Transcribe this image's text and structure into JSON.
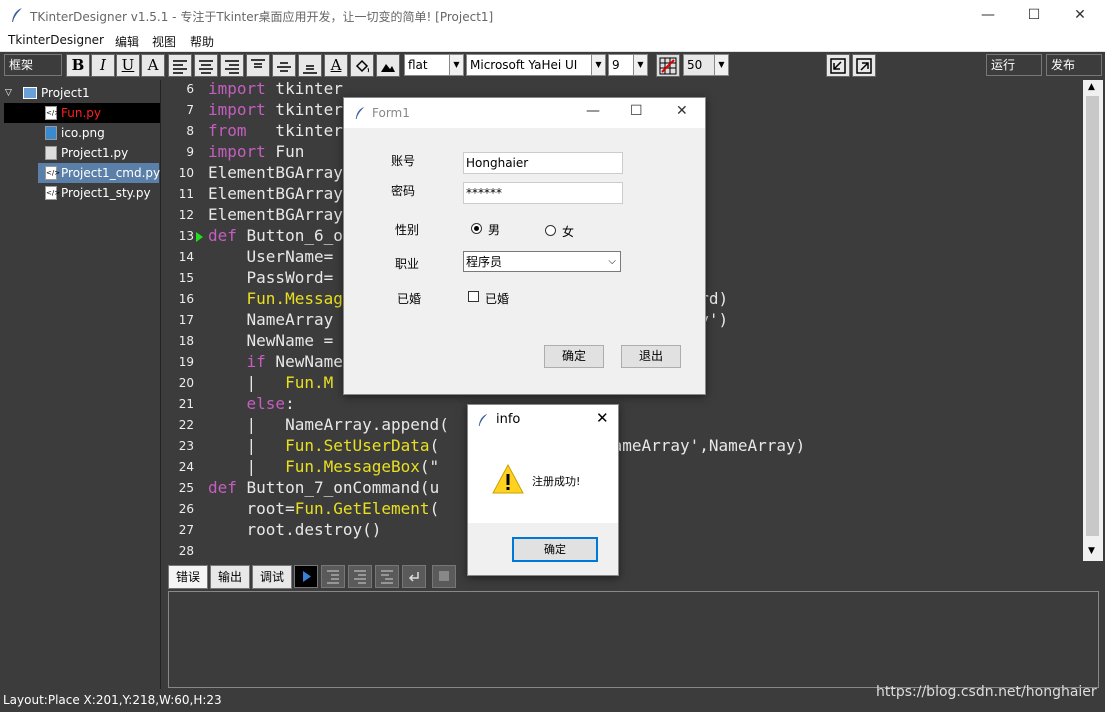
{
  "window": {
    "title": "TKinterDesigner v1.5.1 - 专注于Tkinter桌面应用开发，让一切变的简单!    [Project1]",
    "min": "—",
    "max": "☐",
    "close": "✕"
  },
  "menu": [
    "TkinterDesigner",
    "编辑",
    "视图",
    "帮助"
  ],
  "toolbar": {
    "frame_select": "框架",
    "format_buttons": [
      "B",
      "I",
      "U",
      "A"
    ],
    "relief": "flat",
    "font": "Microsoft YaHei UI",
    "font_size": "9",
    "zoom": "50",
    "run_label": "运行",
    "publish_label": "发布"
  },
  "project_tree": {
    "root": "Project1",
    "files": [
      {
        "name": "Fun.py",
        "state": "active"
      },
      {
        "name": "ico.png",
        "state": "normal"
      },
      {
        "name": "Project1.py",
        "state": "normal"
      },
      {
        "name": "Project1_cmd.py",
        "state": "selected"
      },
      {
        "name": "Project1_sty.py",
        "state": "normal"
      }
    ]
  },
  "editor": {
    "line_numbers": [
      "6",
      "7",
      "8",
      "9",
      "10",
      "11",
      "12",
      "13",
      "14",
      "15",
      "16",
      "17",
      "18",
      "19",
      "20",
      "21",
      "22",
      "23",
      "24",
      "25",
      "26",
      "27",
      "28"
    ],
    "breakpoint_line": "13",
    "lines": [
      {
        "html": "<span class='kw'>import</span> tkinter"
      },
      {
        "html": "<span class='kw'>import</span> tkinter"
      },
      {
        "html": "<span class='kw'>from</span>   tkinter"
      },
      {
        "html": "<span class='kw'>import</span> Fun"
      },
      {
        "html": "ElementBGArray"
      },
      {
        "html": "ElementBGArray"
      },
      {
        "html": "ElementBGArray"
      },
      {
        "html": "<span class='kw'>def</span> Button_6_onCommand("
      },
      {
        "html": "    UserName="
      },
      {
        "html": "    PassWord="
      },
      {
        "html": "    <span class='fn'>Fun.MessageBox</span>(                   Word:\"+PassWord)"
      },
      {
        "html": "    NameArray =                       _3','NameArray')"
      },
      {
        "html": "    NewName ="
      },
      {
        "html": "    <span class='kw'>if</span> NewName"
      },
      {
        "html": "    |   <span class='fn'>Fun.M</span>"
      },
      {
        "html": "    <span class='kw'>else</span>:"
      },
      {
        "html": "    |   NameArray.append("
      },
      {
        "html": "    |   <span class='fn'>Fun.SetUserData</span>(            _3','NameArray',NameArray)"
      },
      {
        "html": "    |   <span class='fn'>Fun.MessageBox</span>(\""
      },
      {
        "html": "<span class='kw'>def</span> Button_7_onCommand(u             ame):"
      },
      {
        "html": "    root=<span class='fn'>Fun.GetElement</span>(              )"
      },
      {
        "html": "    root.destroy()"
      },
      {
        "html": ""
      }
    ]
  },
  "bottom_tabs": [
    "错误",
    "输出",
    "调试"
  ],
  "status": {
    "layout": "Layout:Place  X:201,Y:218,W:60,H:23"
  },
  "watermark": "https://blog.csdn.net/honghaier",
  "form1": {
    "title": "Form1",
    "account_label": "账号",
    "account_value": "Honghaier",
    "password_label": "密码",
    "password_value": "******",
    "gender_label": "性别",
    "gender_male": "男",
    "gender_female": "女",
    "gender_selected": "男",
    "job_label": "职业",
    "job_value": "程序员",
    "married_label": "已婚",
    "married_check": "已婚",
    "married_checked": false,
    "ok_label": "确定",
    "exit_label": "退出"
  },
  "info_dialog": {
    "title": "info",
    "message": "注册成功!",
    "ok_label": "确定"
  }
}
